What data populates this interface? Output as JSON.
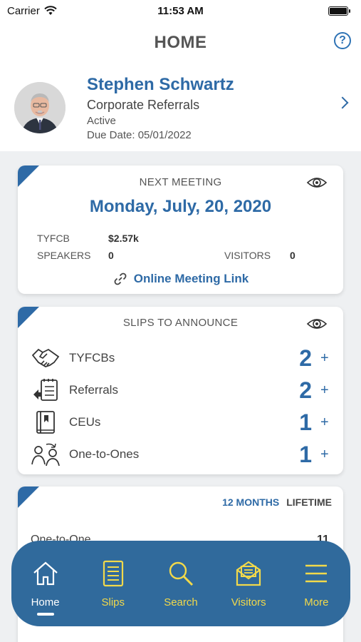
{
  "status_bar": {
    "carrier": "Carrier",
    "time": "11:53 AM"
  },
  "header": {
    "title": "HOME"
  },
  "profile": {
    "name": "Stephen Schwartz",
    "chapter": "Corporate Referrals",
    "status": "Active",
    "due_date": "Due Date:  05/01/2022"
  },
  "next_meeting": {
    "title": "NEXT MEETING",
    "date": "Monday, July, 20, 2020",
    "tyfcb_label": "TYFCB",
    "tyfcb_value": "$2.57k",
    "speakers_label": "SPEAKERS",
    "speakers_value": "0",
    "visitors_label": "VISITORS",
    "visitors_value": "0",
    "link_label": "Online Meeting Link"
  },
  "slips": {
    "title": "SLIPS TO ANNOUNCE",
    "items": [
      {
        "label": "TYFCBs",
        "count": "2",
        "plus": "+",
        "icon": "handshake-icon"
      },
      {
        "label": "Referrals",
        "count": "2",
        "plus": "+",
        "icon": "referral-list-icon"
      },
      {
        "label": "CEUs",
        "count": "1",
        "plus": "+",
        "icon": "book-icon"
      },
      {
        "label": "One-to-Ones",
        "count": "1",
        "plus": "+",
        "icon": "people-exchange-icon"
      }
    ]
  },
  "stats": {
    "tab_12_months": "12 MONTHS",
    "tab_lifetime": "LIFETIME",
    "row_label": "One-to-One",
    "row_value": "11"
  },
  "nav": {
    "items": [
      {
        "label": "Home",
        "icon": "home-icon",
        "active": true
      },
      {
        "label": "Slips",
        "icon": "slips-icon",
        "active": false
      },
      {
        "label": "Search",
        "icon": "search-icon",
        "active": false
      },
      {
        "label": "Visitors",
        "icon": "visitors-icon",
        "active": false
      },
      {
        "label": "More",
        "icon": "menu-icon",
        "active": false
      }
    ]
  },
  "colors": {
    "brand_blue": "#2e6aa6",
    "nav_blue": "#306a9c",
    "nav_yellow": "#f2d94a"
  }
}
